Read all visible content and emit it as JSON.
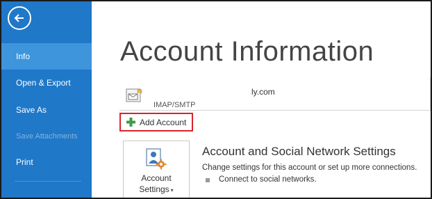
{
  "sidebar": {
    "back_icon": "back-arrow-icon",
    "items": [
      {
        "label": "Info",
        "active": true
      },
      {
        "label": "Open & Export"
      },
      {
        "label": "Save As"
      },
      {
        "label": "Save Attachments",
        "disabled": true
      },
      {
        "label": "Print"
      }
    ]
  },
  "main": {
    "title": "Account Information",
    "account": {
      "email_fragment": "ly.com",
      "type": "IMAP/SMTP",
      "icon": "envelope-account-icon"
    },
    "add_account_label": "Add Account",
    "settings_button": {
      "line1": "Account",
      "line2": "Settings",
      "icon": "account-settings-icon"
    },
    "section": {
      "title": "Account and Social Network Settings",
      "description": "Change settings for this account or set up more connections.",
      "link": "Connect to social networks."
    }
  },
  "colors": {
    "sidebar": "#1f78c8",
    "sidebar_active": "#3e95db",
    "highlight_border": "#d8232a",
    "plus_icon": "#3f9a4a"
  }
}
